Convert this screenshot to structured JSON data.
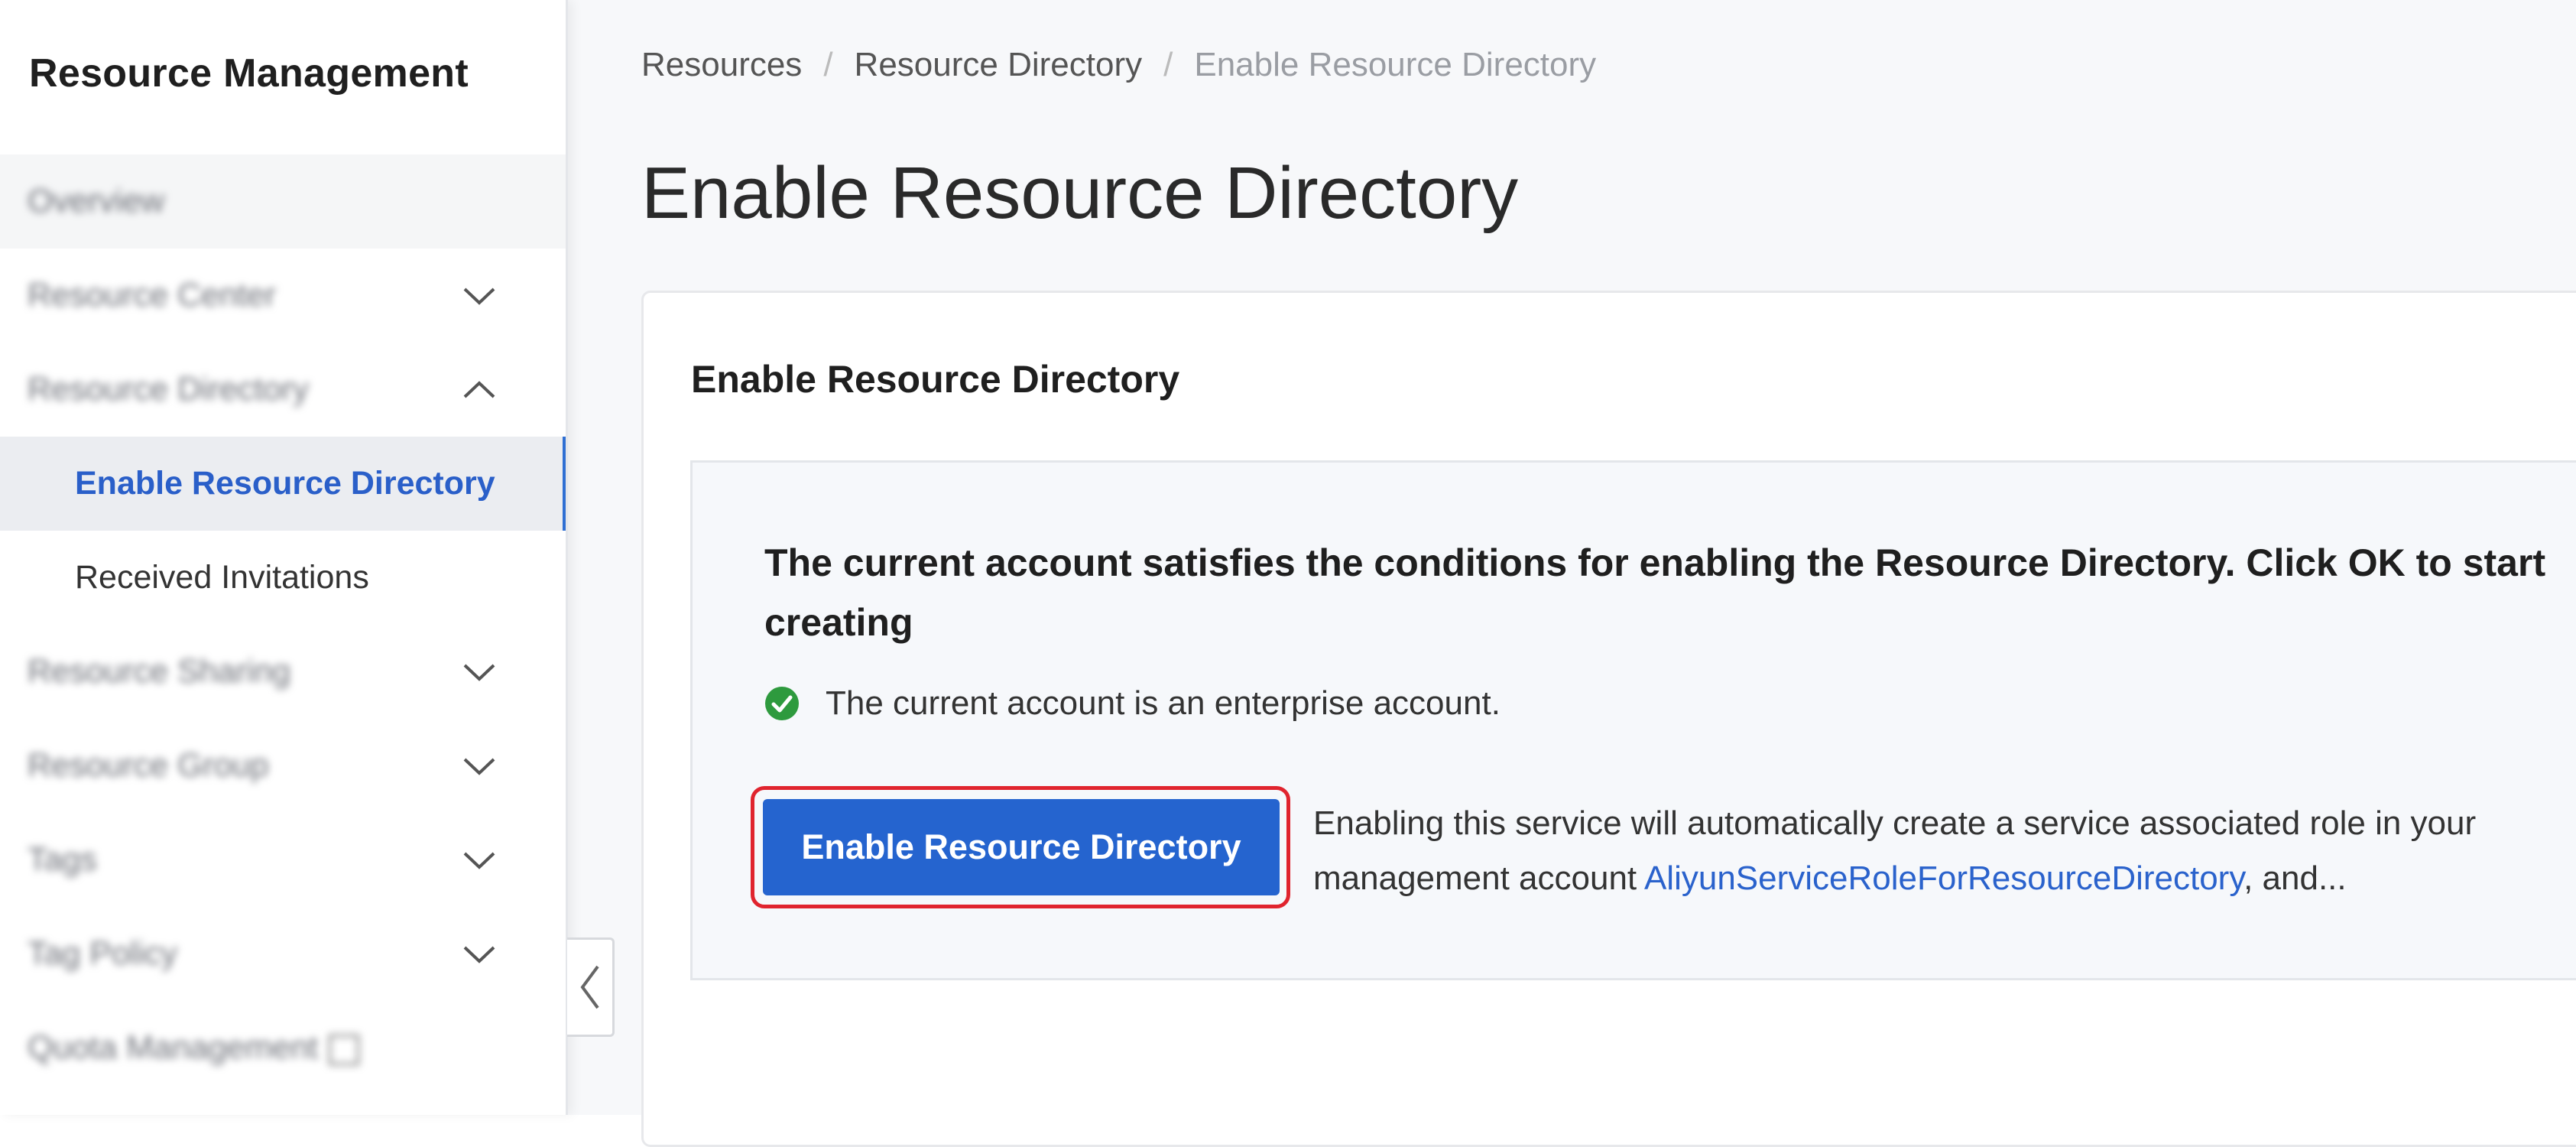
{
  "sidebar": {
    "title": "Resource Management",
    "items": [
      {
        "label": "Overview",
        "blurred": true,
        "chevron": "none"
      },
      {
        "label": "Resource Center",
        "blurred": true,
        "chevron": "down"
      },
      {
        "label": "Resource Directory",
        "blurred": true,
        "chevron": "up"
      },
      {
        "label": "Enable Resource Directory",
        "selected": true,
        "sub": true
      },
      {
        "label": "Received Invitations",
        "sub": true
      },
      {
        "label": "Resource Sharing",
        "blurred": true,
        "chevron": "down"
      },
      {
        "label": "Resource Group",
        "blurred": true,
        "chevron": "down"
      },
      {
        "label": "Tags",
        "blurred": true,
        "chevron": "down"
      },
      {
        "label": "Tag Policy",
        "blurred": true,
        "chevron": "down"
      },
      {
        "label": "Quota Management",
        "blurred": true,
        "chevron": "none",
        "external": true
      }
    ]
  },
  "breadcrumb": {
    "items": [
      "Resources",
      "Resource Directory",
      "Enable Resource Directory"
    ],
    "separator": "/"
  },
  "page": {
    "title": "Enable Resource Directory"
  },
  "card": {
    "title": "Enable Resource Directory",
    "heading": "The current account satisfies the conditions for enabling the Resource Directory. Click OK to start creating",
    "check_text": "The current account is an enterprise account.",
    "button_label": "Enable Resource Directory",
    "note_prefix": "Enabling this service will automatically create a service associated role in your management account ",
    "note_link": "AliyunServiceRoleForResourceDirectory",
    "note_suffix": ", and..."
  },
  "colors": {
    "accent": "#2564cf",
    "link": "#2a62cc",
    "success": "#2e9a3e",
    "highlight": "#e0242e"
  }
}
